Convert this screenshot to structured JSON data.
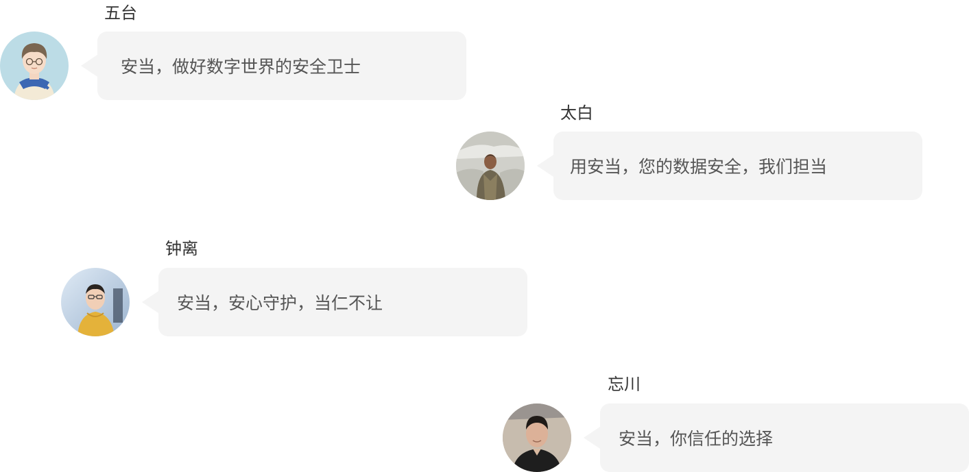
{
  "messages": [
    {
      "name": "五台",
      "text": "安当，做好数字世界的安全卫士",
      "avatar_icon": "cartoon-boy-avatar-icon"
    },
    {
      "name": "太白",
      "text": "用安当，您的数据安全，我们担当",
      "avatar_icon": "outdoor-photo-avatar-icon"
    },
    {
      "name": "钟离",
      "text": "安当，安心守护，当仁不让",
      "avatar_icon": "yellow-hoodie-avatar-icon"
    },
    {
      "name": "忘川",
      "text": "安当，你信任的选择",
      "avatar_icon": "beach-portrait-avatar-icon"
    }
  ],
  "colors": {
    "bubble_bg": "#f4f4f4",
    "bubble_text": "#555555",
    "name_text": "#333333"
  }
}
